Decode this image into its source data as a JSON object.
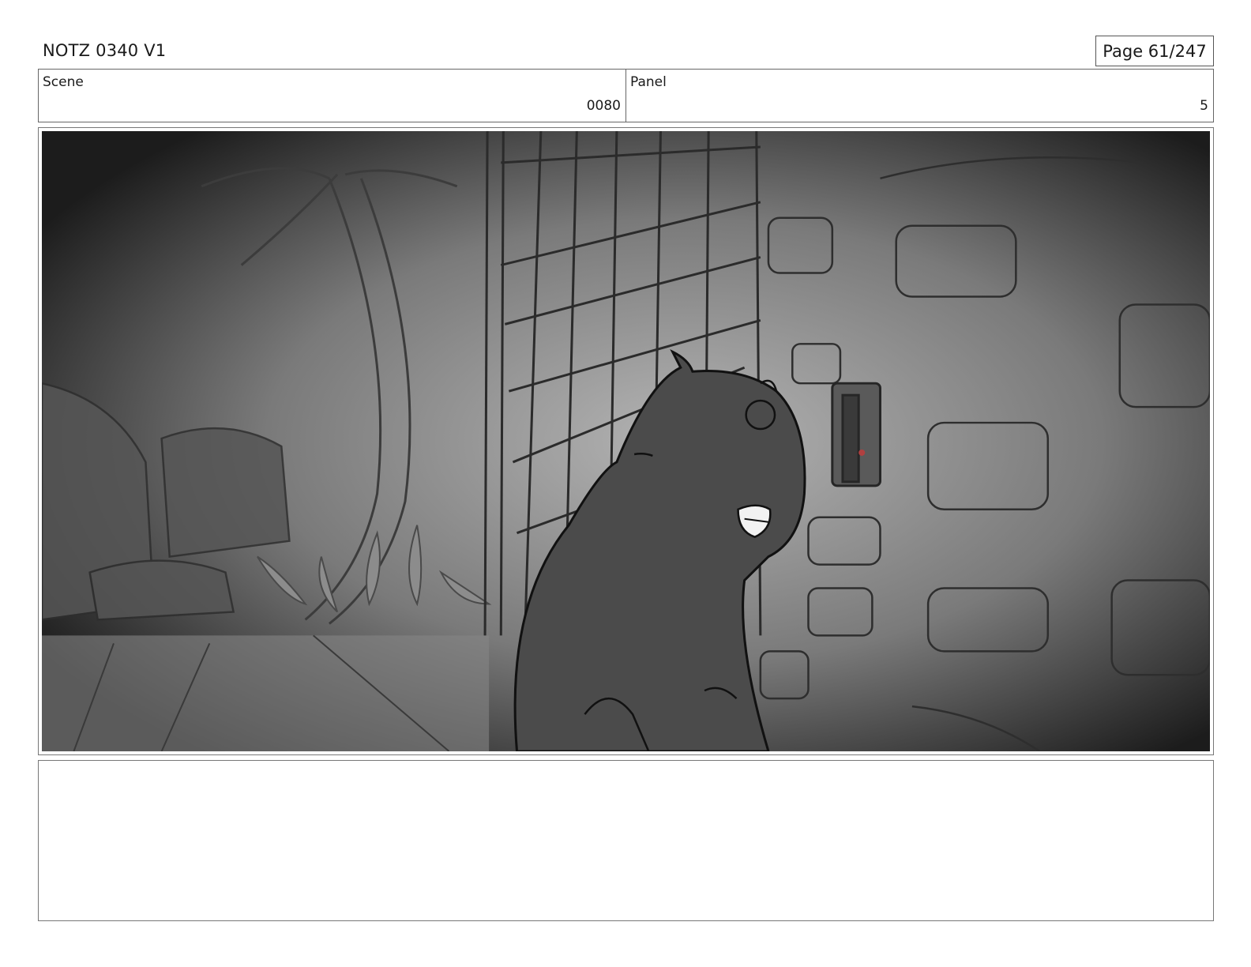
{
  "document": {
    "title": "NOTZ 0340 V1",
    "page_label": "Page  61/247"
  },
  "header": {
    "scene_label": "Scene",
    "scene_value": "0080",
    "panel_label": "Panel",
    "panel_value": "5"
  },
  "panel": {
    "image_subject": "storyboard-sketch-cat-by-cage-gate",
    "palette": {
      "dark": "#1c1c1c",
      "mid": "#6e6e6e",
      "light": "#b4b4b4",
      "line": "#2a2a2a"
    }
  },
  "notes": {
    "text": ""
  }
}
